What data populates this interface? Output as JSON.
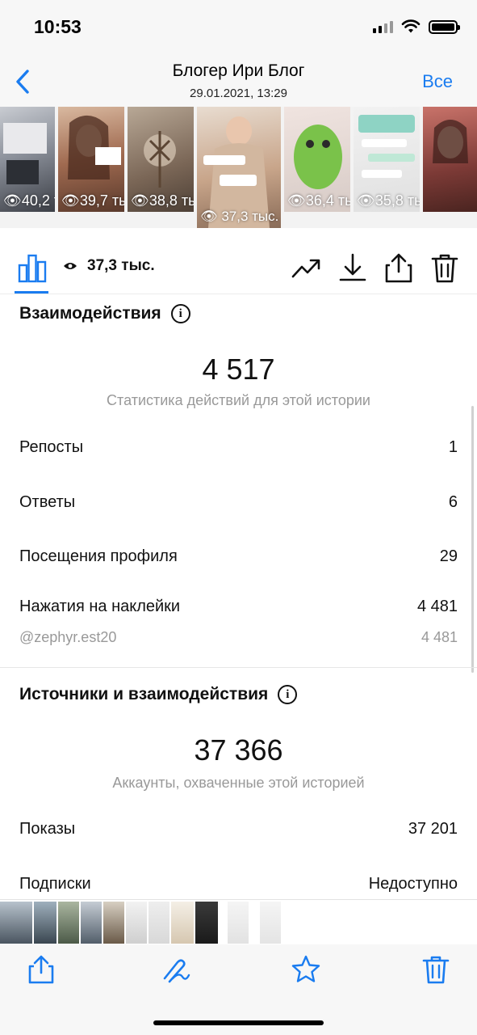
{
  "status_bar": {
    "time": "10:53"
  },
  "nav": {
    "title": "Блогер  Ири Блог",
    "subtitle": "29.01.2021, 13:29",
    "all_label": "Все"
  },
  "stories": [
    {
      "views": "40,2 ты"
    },
    {
      "views": "39,7 ты"
    },
    {
      "views": "38,8 ты"
    },
    {
      "views": "37,3 тыс."
    },
    {
      "views": "36,4 ты"
    },
    {
      "views": "35,8 ты"
    },
    {
      "views": ""
    }
  ],
  "actions": {
    "views_count": "37,3 тыс."
  },
  "interactions": {
    "title": "Взаимодействия",
    "total": "4 517",
    "caption": "Статистика действий для этой истории",
    "rows": [
      {
        "label": "Репосты",
        "value": "1"
      },
      {
        "label": "Ответы",
        "value": "6"
      },
      {
        "label": "Посещения профиля",
        "value": "29"
      },
      {
        "label": "Нажатия на наклейки",
        "value": "4 481"
      }
    ],
    "sticker_row": {
      "label": "@zephyr.est20",
      "value": "4 481"
    }
  },
  "sources": {
    "title": "Источники и взаимодействия",
    "total": "37 366",
    "caption": "Аккаунты, охваченные этой историей",
    "rows": [
      {
        "label": "Показы",
        "value": "37 201"
      },
      {
        "label": "Подписки",
        "value": "Недоступно"
      }
    ]
  },
  "colors": {
    "accent": "#1a7cf0",
    "muted": "#999999"
  }
}
